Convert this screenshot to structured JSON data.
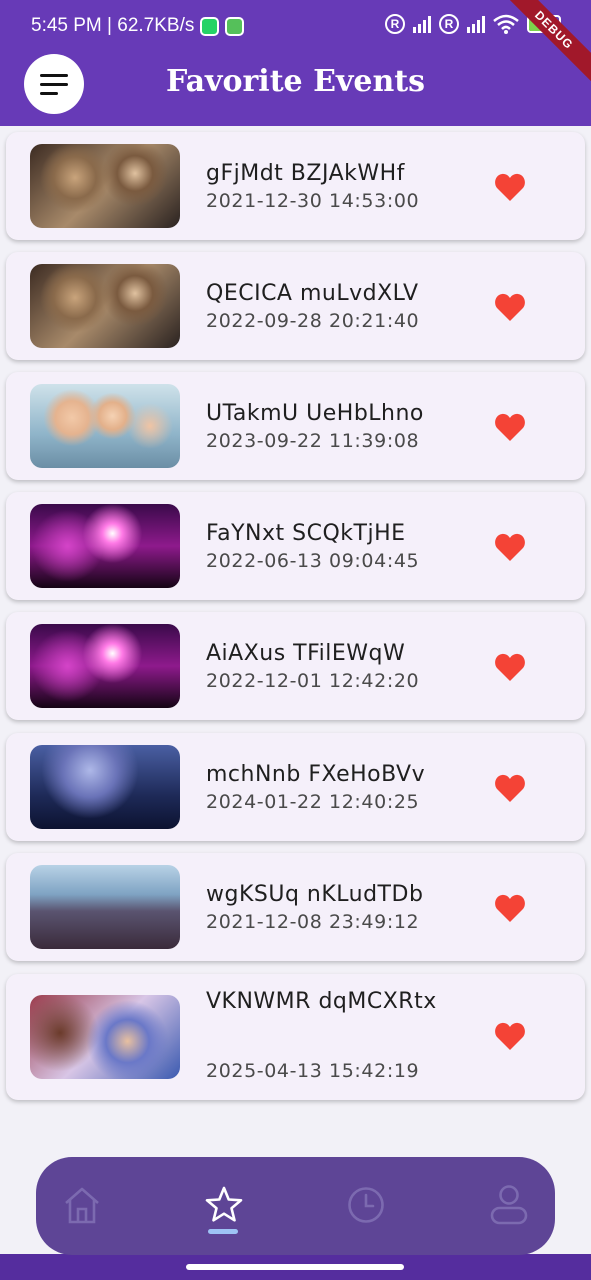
{
  "status_bar": {
    "time_and_speed": "5:45 PM | 62.7KB/s",
    "reg_marks": [
      "R",
      "R"
    ],
    "battery_level": "76",
    "battery_fraction": 0.76
  },
  "debug_banner": "DEBUG",
  "app_bar": {
    "title": "Favorite Events",
    "menu_icon": "hamburger-menu-icon"
  },
  "events": [
    {
      "name": "gFjMdt BZJAkWHf",
      "date": "2021-12-30 14:53:00",
      "thumbnail": "party-people-photo",
      "favorited": true
    },
    {
      "name": "QECICA muLvdXLV",
      "date": "2022-09-28 20:21:40",
      "thumbnail": "party-people-photo",
      "favorited": true
    },
    {
      "name": "UTakmU UeHbLhno",
      "date": "2023-09-22 11:39:08",
      "thumbnail": "kids-birthday-photo",
      "favorited": true
    },
    {
      "name": "FaYNxt SCQkTjHE",
      "date": "2022-06-13 09:04:45",
      "thumbnail": "concert-lights-photo",
      "favorited": true
    },
    {
      "name": "AiAXus TFilEWqW",
      "date": "2022-12-01 12:42:20",
      "thumbnail": "concert-lights-photo",
      "favorited": true
    },
    {
      "name": "mchNnb FXeHoBVv",
      "date": "2024-01-22 12:40:25",
      "thumbnail": "crowd-hands-photo",
      "favorited": true
    },
    {
      "name": "wgKSUq nKLudTDb",
      "date": "2021-12-08 23:49:12",
      "thumbnail": "street-festival-photo",
      "favorited": true
    },
    {
      "name": "VKNWMR dqMCXRtx",
      "date": "2025-04-13 15:42:19",
      "thumbnail": "club-dancing-photo",
      "favorited": true
    }
  ],
  "bottom_nav": {
    "items": [
      {
        "icon": "home-icon",
        "selected": false
      },
      {
        "icon": "star-icon",
        "selected": true
      },
      {
        "icon": "clock-icon",
        "selected": false
      },
      {
        "icon": "profile-icon",
        "selected": false
      }
    ]
  },
  "colors": {
    "app_bar": "#673ab7",
    "heart": "#f44336",
    "nav_background": "#5e4596",
    "nav_indicator": "#9ec3f5",
    "card_background": "#f5f0fa"
  }
}
